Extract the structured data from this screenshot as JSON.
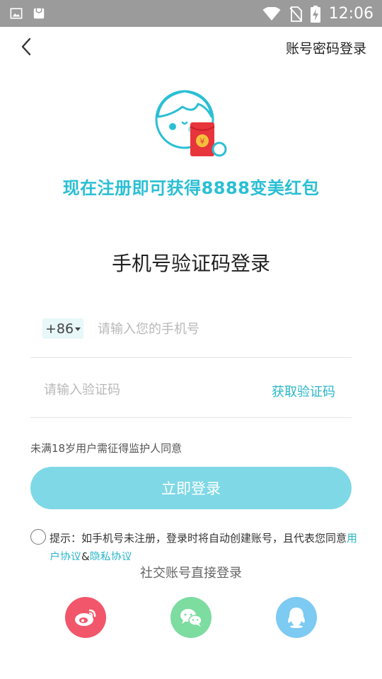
{
  "status_bar": {
    "time": "12:06",
    "icons": [
      "image-icon",
      "notification-icon",
      "wifi-icon",
      "no-sim-icon",
      "battery-charging-icon"
    ]
  },
  "header": {
    "back_icon": "chevron-left-icon",
    "password_login_label": "账号密码登录"
  },
  "promo": {
    "text": "现在注册即可获得8888变美红包",
    "accent_color": "#2bbfd4"
  },
  "title": "手机号验证码登录",
  "phone": {
    "country_code": "+86",
    "placeholder": "请输入您的手机号",
    "value": ""
  },
  "code": {
    "placeholder": "请输入验证码",
    "value": "",
    "get_code_label": "获取验证码"
  },
  "age_notice": "未满18岁用户需征得监护人同意",
  "login_button_label": "立即登录",
  "agreement": {
    "checked": false,
    "text_prefix": "提示：如手机号未注册，登录时将自动创建账号，且代表您同意",
    "user_agreement_label": "用户协议",
    "separator": "&",
    "privacy_label": "隐私协议"
  },
  "social": {
    "title": "社交账号直接登录",
    "buttons": [
      {
        "icon": "weibo-icon",
        "color": "#f2566b"
      },
      {
        "icon": "wechat-icon",
        "color": "#7ddca0"
      },
      {
        "icon": "qq-icon",
        "color": "#7dcaf2"
      }
    ]
  },
  "colors": {
    "accent": "#2bb7c9",
    "login_button": "#7fd8e6"
  }
}
